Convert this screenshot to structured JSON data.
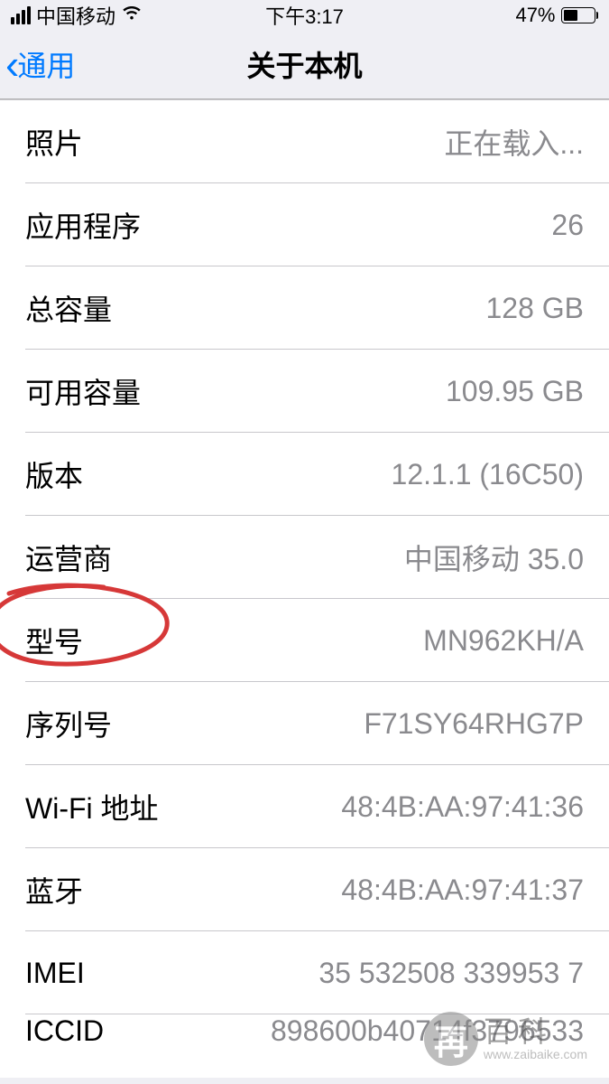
{
  "statusBar": {
    "carrier": "中国移动",
    "time": "下午3:17",
    "batteryPct": "47%"
  },
  "nav": {
    "backLabel": "通用",
    "title": "关于本机"
  },
  "rows": [
    {
      "label": "照片",
      "value": "正在载入..."
    },
    {
      "label": "应用程序",
      "value": "26"
    },
    {
      "label": "总容量",
      "value": "128 GB"
    },
    {
      "label": "可用容量",
      "value": "109.95 GB"
    },
    {
      "label": "版本",
      "value": "12.1.1 (16C50)"
    },
    {
      "label": "运营商",
      "value": "中国移动 35.0"
    },
    {
      "label": "型号",
      "value": "MN962KH/A"
    },
    {
      "label": "序列号",
      "value": "F71SY64RHG7P"
    },
    {
      "label": "Wi-Fi 地址",
      "value": "48:4B:AA:97:41:36"
    },
    {
      "label": "蓝牙",
      "value": "48:4B:AA:97:41:37"
    },
    {
      "label": "IMEI",
      "value": "35 532508 339953 7"
    },
    {
      "label": "ICCID",
      "value": "898600b40714f3796533"
    }
  ],
  "watermark": {
    "char": "再",
    "text1": "百科",
    "text2": "www.zaibaike.com"
  }
}
